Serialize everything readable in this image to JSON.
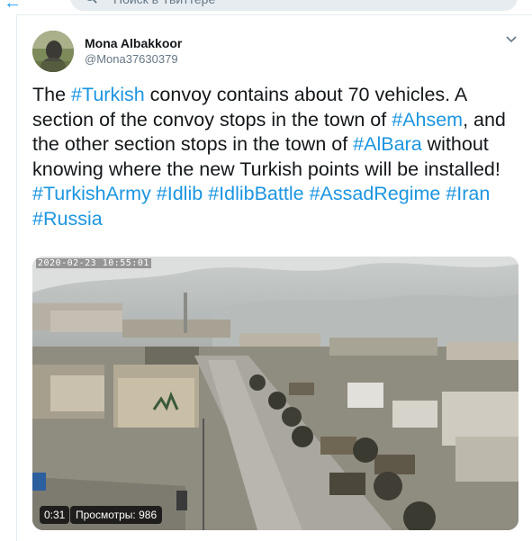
{
  "search": {
    "placeholder": "Поиск в Твиттере"
  },
  "tweet": {
    "author_name": "Mona Albakkoor",
    "author_handle": "@Mona37630379",
    "segments": [
      {
        "text": "The ",
        "tag": false
      },
      {
        "text": "#Turkish",
        "tag": true
      },
      {
        "text": " convoy contains about 70 vehicles. A section of the convoy stops in the town of ",
        "tag": false
      },
      {
        "text": "#Ahsem",
        "tag": true
      },
      {
        "text": ", and the other section stops in the town of ",
        "tag": false
      },
      {
        "text": "#AlBara",
        "tag": true
      },
      {
        "text": " without knowing where the new Turkish points will be installed! ",
        "tag": false
      },
      {
        "text": "#TurkishArmy",
        "tag": true
      },
      {
        "text": " ",
        "tag": false
      },
      {
        "text": "#Idlib",
        "tag": true
      },
      {
        "text": " ",
        "tag": false
      },
      {
        "text": "#IdlibBattle",
        "tag": true
      },
      {
        "text": " ",
        "tag": false
      },
      {
        "text": "#AssadRegime",
        "tag": true
      },
      {
        "text": " ",
        "tag": false
      },
      {
        "text": "#Iran",
        "tag": true
      },
      {
        "text": " ",
        "tag": false
      },
      {
        "text": "#Russia",
        "tag": true
      }
    ]
  },
  "video": {
    "timestamp": "2020-02-23  10:55:01",
    "duration": "0:31",
    "views": "Просмотры: 986"
  },
  "colors": {
    "link": "#1b95e0",
    "text": "#14171a",
    "muted": "#657786"
  },
  "icons": {
    "back": "back-arrow-icon",
    "search": "search-icon",
    "menu": "chevron-down-icon"
  }
}
